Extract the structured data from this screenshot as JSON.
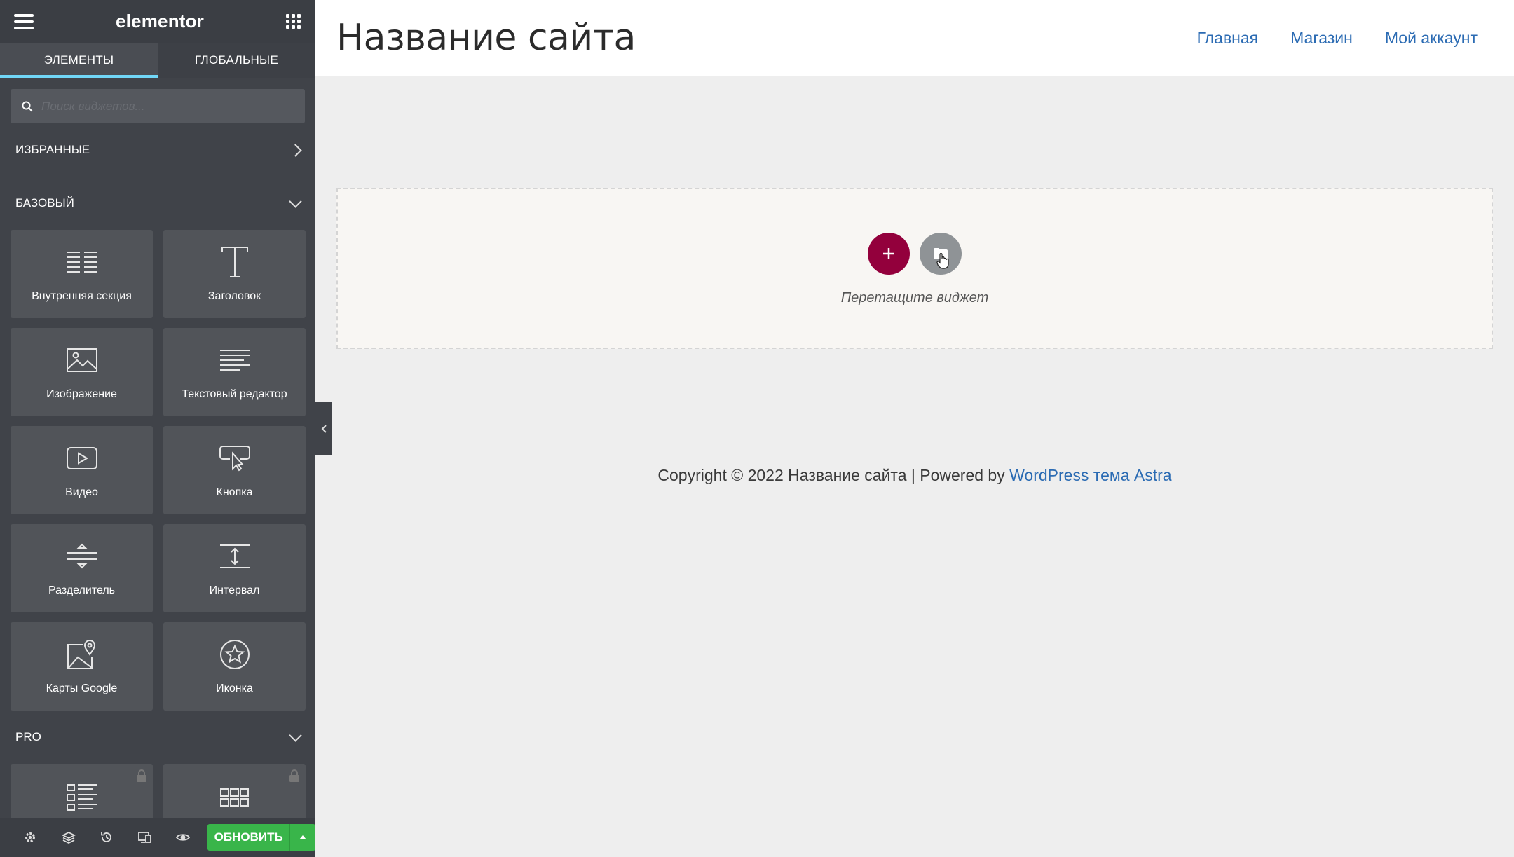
{
  "sidebar": {
    "logo": "elementor",
    "tabs": [
      {
        "label": "ЭЛЕМЕНТЫ",
        "active": true
      },
      {
        "label": "ГЛОБАЛЬНЫЕ",
        "active": false
      }
    ],
    "search_placeholder": "Поиск виджетов...",
    "sections": {
      "favorites": "ИЗБРАННЫЕ",
      "basic": "БАЗОВЫЙ",
      "pro": "PRO"
    },
    "widgets": [
      {
        "label": "Внутренняя секция",
        "icon": "inner-section-icon"
      },
      {
        "label": "Заголовок",
        "icon": "heading-icon"
      },
      {
        "label": "Изображение",
        "icon": "image-icon"
      },
      {
        "label": "Текстовый редактор",
        "icon": "text-editor-icon"
      },
      {
        "label": "Видео",
        "icon": "video-icon"
      },
      {
        "label": "Кнопка",
        "icon": "button-icon"
      },
      {
        "label": "Разделитель",
        "icon": "divider-icon"
      },
      {
        "label": "Интервал",
        "icon": "spacer-icon"
      },
      {
        "label": "Карты Google",
        "icon": "google-maps-icon"
      },
      {
        "label": "Иконка",
        "icon": "star-icon"
      }
    ],
    "pro_widgets": [
      {
        "icon": "posts-icon",
        "locked": true
      },
      {
        "icon": "portfolio-icon",
        "locked": true
      }
    ],
    "footer": {
      "update_label": "ОБНОВИТЬ",
      "accent": "#39b54a"
    }
  },
  "site": {
    "title": "Название сайта",
    "nav": [
      "Главная",
      "Магазин",
      "Мой аккаунт"
    ],
    "drop_text": "Перетащите виджет",
    "copyright_prefix": "Copyright © 2022 Название сайта | Powered by ",
    "copyright_link": "WordPress тема Astra"
  },
  "colors": {
    "sidebar_bg": "#404349",
    "tab_indicator": "#71d7f7",
    "add_button": "#93003c",
    "link": "#2b6bb3"
  }
}
